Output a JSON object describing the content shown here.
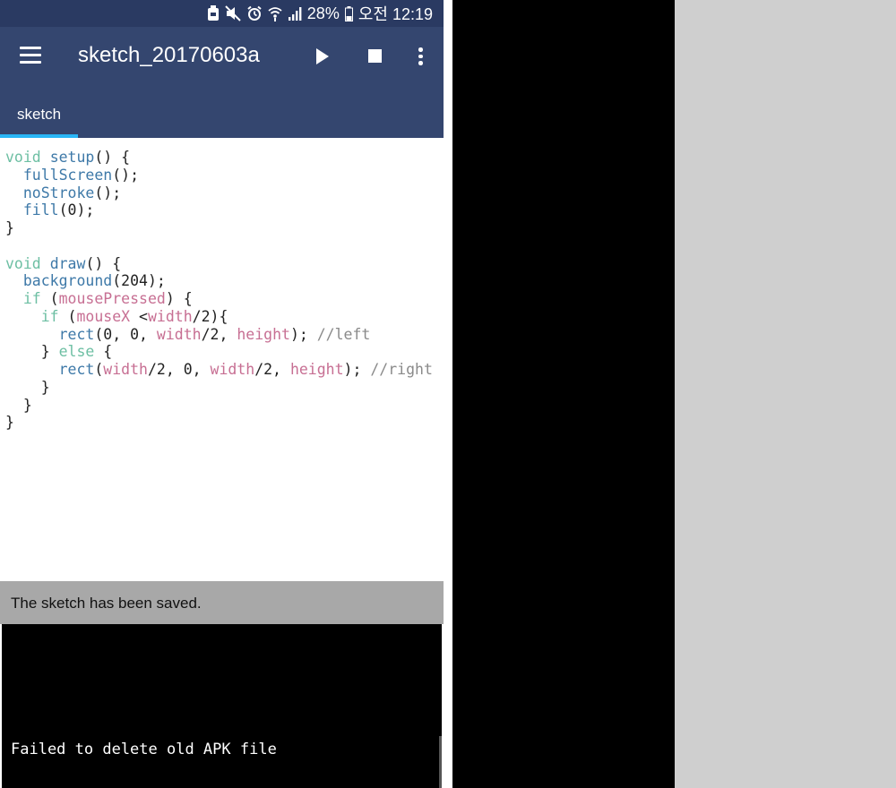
{
  "status_bar": {
    "icons": [
      "app-notification-icon",
      "mute-icon",
      "alarm-icon",
      "wifi-icon",
      "signal-icon"
    ],
    "battery": "28%",
    "time": "오전 12:19"
  },
  "app_bar": {
    "title": "sketch_20170603a",
    "actions": [
      "menu-icon",
      "play-icon",
      "stop-icon",
      "more-vert-icon"
    ]
  },
  "tabs": [
    {
      "label": "sketch",
      "active": true
    }
  ],
  "editor": {
    "lines": [
      [
        {
          "t": "kw",
          "s": "void"
        },
        {
          "t": "",
          "s": " "
        },
        {
          "t": "fn",
          "s": "setup"
        },
        {
          "t": "",
          "s": "() {"
        }
      ],
      [
        {
          "t": "",
          "s": "  "
        },
        {
          "t": "fn",
          "s": "fullScreen"
        },
        {
          "t": "",
          "s": "();"
        }
      ],
      [
        {
          "t": "",
          "s": "  "
        },
        {
          "t": "fn",
          "s": "noStroke"
        },
        {
          "t": "",
          "s": "();"
        }
      ],
      [
        {
          "t": "",
          "s": "  "
        },
        {
          "t": "fn",
          "s": "fill"
        },
        {
          "t": "",
          "s": "(0);"
        }
      ],
      [
        {
          "t": "",
          "s": "}"
        }
      ],
      [
        {
          "t": "",
          "s": ""
        }
      ],
      [
        {
          "t": "kw",
          "s": "void"
        },
        {
          "t": "",
          "s": " "
        },
        {
          "t": "fn",
          "s": "draw"
        },
        {
          "t": "",
          "s": "() {"
        }
      ],
      [
        {
          "t": "",
          "s": "  "
        },
        {
          "t": "fn",
          "s": "background"
        },
        {
          "t": "",
          "s": "(204);"
        }
      ],
      [
        {
          "t": "",
          "s": "  "
        },
        {
          "t": "kw",
          "s": "if"
        },
        {
          "t": "",
          "s": " ("
        },
        {
          "t": "var",
          "s": "mousePressed"
        },
        {
          "t": "",
          "s": ") {"
        }
      ],
      [
        {
          "t": "",
          "s": "    "
        },
        {
          "t": "kw",
          "s": "if"
        },
        {
          "t": "",
          "s": " ("
        },
        {
          "t": "var",
          "s": "mouseX"
        },
        {
          "t": "",
          "s": " <"
        },
        {
          "t": "var",
          "s": "width"
        },
        {
          "t": "",
          "s": "/2){"
        }
      ],
      [
        {
          "t": "",
          "s": "      "
        },
        {
          "t": "fn",
          "s": "rect"
        },
        {
          "t": "",
          "s": "(0, 0, "
        },
        {
          "t": "var",
          "s": "width"
        },
        {
          "t": "",
          "s": "/2, "
        },
        {
          "t": "var",
          "s": "height"
        },
        {
          "t": "",
          "s": "); "
        },
        {
          "t": "cm",
          "s": "//left"
        }
      ],
      [
        {
          "t": "",
          "s": "    } "
        },
        {
          "t": "kw",
          "s": "else"
        },
        {
          "t": "",
          "s": " {"
        }
      ],
      [
        {
          "t": "",
          "s": "      "
        },
        {
          "t": "fn",
          "s": "rect"
        },
        {
          "t": "",
          "s": "("
        },
        {
          "t": "var",
          "s": "width"
        },
        {
          "t": "",
          "s": "/2, 0, "
        },
        {
          "t": "var",
          "s": "width"
        },
        {
          "t": "",
          "s": "/2, "
        },
        {
          "t": "var",
          "s": "height"
        },
        {
          "t": "",
          "s": "); "
        },
        {
          "t": "cm",
          "s": "//right"
        }
      ],
      [
        {
          "t": "",
          "s": "    }"
        }
      ],
      [
        {
          "t": "",
          "s": "  }"
        }
      ],
      [
        {
          "t": "",
          "s": "}"
        }
      ]
    ]
  },
  "message_bar": {
    "text": "The sketch has been saved."
  },
  "console": {
    "text": "Failed to delete old APK file"
  },
  "colors": {
    "app_bar": "#34466f",
    "status_bar": "#2a3a62",
    "tab_indicator": "#29b6f6",
    "keyword": "#6dbfa3",
    "function": "#3e79a8",
    "variable": "#c76f93",
    "comment": "#8a8a8a"
  }
}
